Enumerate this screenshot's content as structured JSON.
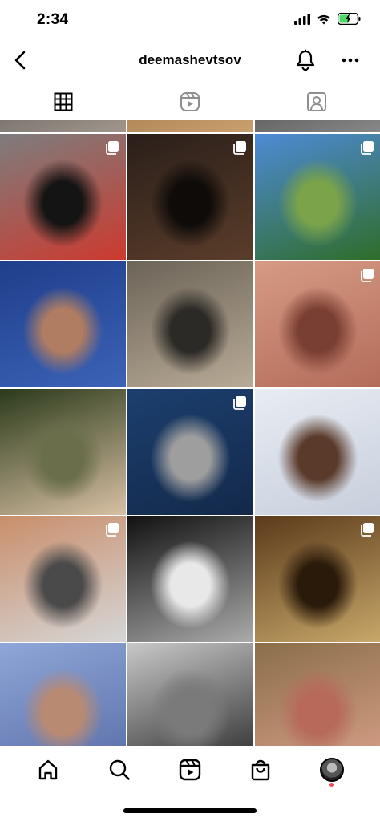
{
  "status": {
    "time": "2:34"
  },
  "header": {
    "username": "deemashevtsov"
  },
  "tabs": [
    {
      "name": "posts-grid",
      "icon": "grid-icon",
      "active": true
    },
    {
      "name": "reels",
      "icon": "reels-icon",
      "active": false
    },
    {
      "name": "tagged",
      "icon": "tagged-icon",
      "active": false
    }
  ],
  "grid": {
    "posts": [
      {
        "desc": "top partial row 1",
        "colors": [
          "#3a3a3a",
          "#a0968c"
        ],
        "multi": false
      },
      {
        "desc": "top partial row 2",
        "colors": [
          "#8b5a2b",
          "#c8a06e"
        ],
        "multi": false
      },
      {
        "desc": "top partial row 3",
        "colors": [
          "#222",
          "#888"
        ],
        "multi": false
      },
      {
        "desc": "man with sunglasses in front of red poster",
        "colors": [
          "#7d7d7d",
          "#cc3a2f",
          "#141414"
        ],
        "multi": true
      },
      {
        "desc": "man lighting cigarette in bar",
        "colors": [
          "#2a1f1a",
          "#5b3d2a",
          "#0e0b09"
        ],
        "multi": true
      },
      {
        "desc": "person sitting in park",
        "colors": [
          "#4e8ad6",
          "#2f6d2a",
          "#7aa34a"
        ],
        "multi": true
      },
      {
        "desc": "portrait against blue sky",
        "colors": [
          "#1f3e8a",
          "#3c63b8",
          "#b07d62"
        ],
        "multi": false
      },
      {
        "desc": "two people walking street",
        "colors": [
          "#6c6458",
          "#b8aa96",
          "#2c2a26"
        ],
        "multi": false
      },
      {
        "desc": "close-up of eye",
        "colors": [
          "#d59b84",
          "#b46c5a",
          "#7a3f33"
        ],
        "multi": true
      },
      {
        "desc": "man in cap with flowers",
        "colors": [
          "#2a3a1a",
          "#d8c0a4",
          "#6a6e4a"
        ],
        "multi": false
      },
      {
        "desc": "man standing at sea",
        "colors": [
          "#1c3f6e",
          "#13294a",
          "#9e9e9e"
        ],
        "multi": true
      },
      {
        "desc": "person in snow",
        "colors": [
          "#e8ecf3",
          "#c7cfdc",
          "#5a3a2a"
        ],
        "multi": false
      },
      {
        "desc": "man in street near buildings",
        "colors": [
          "#c98e6b",
          "#d6d6d6",
          "#4a4a4a"
        ],
        "multi": true
      },
      {
        "desc": "black and white escalator collage",
        "colors": [
          "#111",
          "#aaa",
          "#e8e8e8"
        ],
        "multi": false
      },
      {
        "desc": "theatre interior",
        "colors": [
          "#5a3a1a",
          "#c8a76a",
          "#2a1a0a"
        ],
        "multi": true
      },
      {
        "desc": "man with headphones",
        "colors": [
          "#8fa6d8",
          "#5a6fa8",
          "#b98a72"
        ],
        "multi": false
      },
      {
        "desc": "black and white couple",
        "colors": [
          "#c8c8c8",
          "#2a2a2a",
          "#7a7a7a"
        ],
        "multi": false
      },
      {
        "desc": "man in fur hat",
        "colors": [
          "#8a6e4a",
          "#d8a088",
          "#b76a5a"
        ],
        "multi": false
      }
    ]
  },
  "bottom_nav": [
    {
      "name": "nav-home",
      "icon": "home-icon"
    },
    {
      "name": "nav-search",
      "icon": "search-icon"
    },
    {
      "name": "nav-reels",
      "icon": "reels-icon"
    },
    {
      "name": "nav-shop",
      "icon": "shop-bag-icon"
    },
    {
      "name": "nav-profile",
      "icon": "avatar"
    }
  ]
}
